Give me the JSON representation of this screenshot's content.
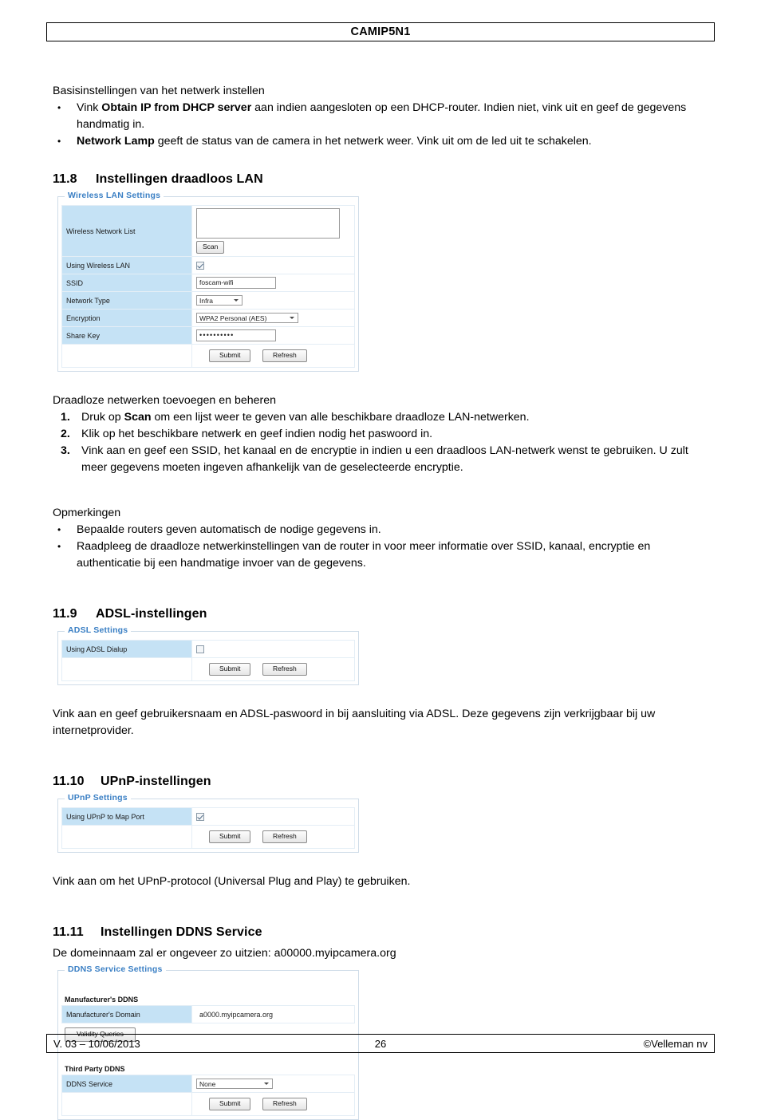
{
  "header": {
    "title": "CAMIP5N1"
  },
  "footer": {
    "version": "V. 03 – 10/06/2013",
    "page_number": "26",
    "copyright": "©Velleman nv"
  },
  "intro": {
    "lead": "Basisinstellingen van het netwerk instellen",
    "bullets": [
      {
        "prefix": "Vink ",
        "bold": "Obtain IP from DHCP server",
        "suffix": " aan indien aangesloten op een DHCP-router. Indien niet, vink uit en geef de gegevens handmatig in."
      },
      {
        "prefix": "",
        "bold": "Network Lamp",
        "suffix": " geeft de status van de camera in het netwerk weer. Vink uit om de led uit te schakelen."
      }
    ]
  },
  "section_wlan": {
    "number": "11.8",
    "title": "Instellingen draadloos LAN",
    "panel": {
      "legend": "Wireless LAN Settings",
      "rows": [
        {
          "label": "Wireless Network List",
          "widget": "listbox-and-scan",
          "scan_label": "Scan"
        },
        {
          "label": "Using Wireless LAN",
          "widget": "checkbox",
          "checked": true
        },
        {
          "label": "SSID",
          "widget": "text",
          "value": "foscam-wifi"
        },
        {
          "label": "Network Type",
          "widget": "select",
          "value": "Infra"
        },
        {
          "label": "Encryption",
          "widget": "select",
          "value": "WPA2 Personal (AES)"
        },
        {
          "label": "Share Key",
          "widget": "password",
          "value": "••••••••••"
        }
      ],
      "submit_label": "Submit",
      "refresh_label": "Refresh"
    },
    "after_lead": "Draadloze netwerken toevoegen en beheren",
    "steps": [
      {
        "prefix": "Druk op ",
        "bold": "Scan",
        "suffix": " om een lijst weer te geven van alle beschikbare draadloze LAN-netwerken."
      },
      {
        "prefix": "Klik op het beschikbare netwerk en geef indien nodig het paswoord in.",
        "bold": "",
        "suffix": ""
      },
      {
        "prefix": "Vink aan en geef een SSID, het kanaal en de encryptie in indien u een draadloos LAN-netwerk wenst te gebruiken. U zult meer gegevens moeten ingeven afhankelijk van de geselecteerde encryptie.",
        "bold": "",
        "suffix": ""
      }
    ],
    "notes_lead": "Opmerkingen",
    "notes": [
      "Bepaalde routers geven automatisch de nodige gegevens in.",
      "Raadpleeg de draadloze netwerkinstellingen van de router in voor meer informatie over SSID, kanaal, encryptie en authenticatie bij een handmatige invoer van de gegevens."
    ]
  },
  "section_adsl": {
    "number": "11.9",
    "title": "ADSL-instellingen",
    "panel": {
      "legend": "ADSL Settings",
      "row_label": "Using ADSL Dialup",
      "checked": false,
      "submit_label": "Submit",
      "refresh_label": "Refresh"
    },
    "body": "Vink aan en geef gebruikersnaam en ADSL-paswoord in bij aansluiting via ADSL. Deze gegevens zijn verkrijgbaar bij uw internetprovider."
  },
  "section_upnp": {
    "number": "11.10",
    "title": "UPnP-instellingen",
    "panel": {
      "legend": "UPnP Settings",
      "row_label": "Using UPnP to Map Port",
      "checked": true,
      "submit_label": "Submit",
      "refresh_label": "Refresh"
    },
    "body": "Vink aan om het UPnP-protocol (Universal Plug and Play) te gebruiken."
  },
  "section_ddns": {
    "number": "11.11",
    "title": "Instellingen DDNS Service",
    "body": "De domeinnaam zal er ongeveer zo uitzien: a00000.myipcamera.org",
    "panel": {
      "legend": "DDNS Service Settings",
      "group1_title": "Manufacturer's DDNS",
      "domain_label": "Manufacturer's Domain",
      "domain_value": "a0000.myipcamera.org",
      "validity_label": "Validity Queries",
      "group2_title": "Third Party DDNS",
      "service_label": "DDNS Service",
      "service_value": "None",
      "submit_label": "Submit",
      "refresh_label": "Refresh"
    }
  },
  "colors": {
    "panel_legend": "#3a7fc4",
    "row_label_bg": "#c5e2f5",
    "panel_border": "#cfdce8"
  }
}
